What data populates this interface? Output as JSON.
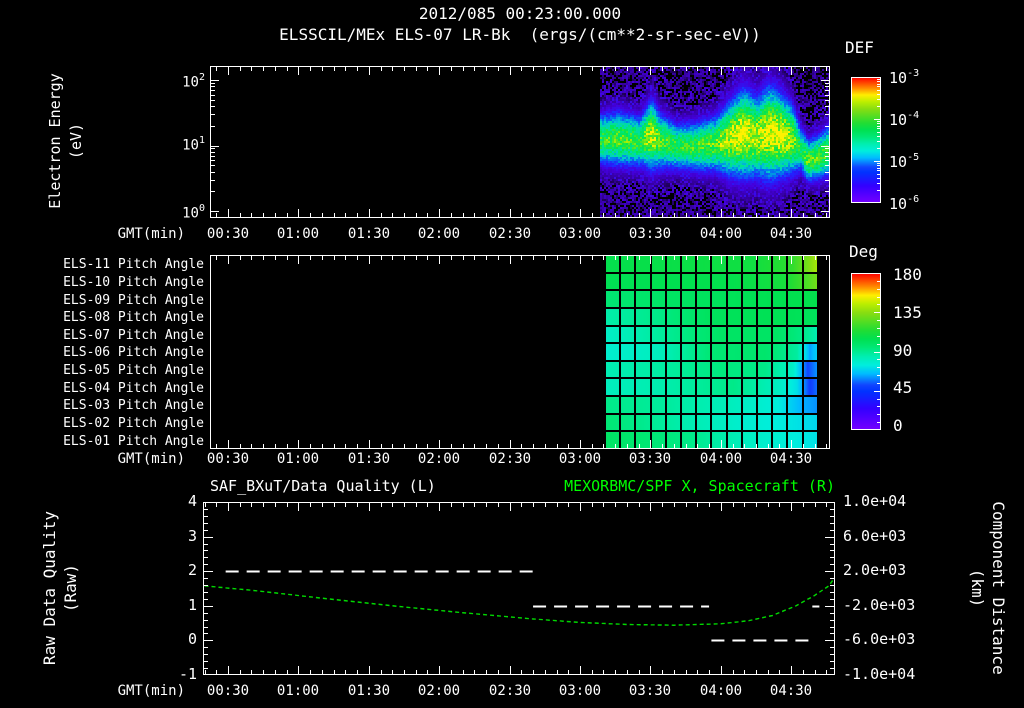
{
  "colors": {
    "background": "#000000",
    "foreground": "#ffffff",
    "trace_green": "#00d800",
    "title_green": "#00ff00",
    "quality_dash_white": "#ffffff"
  },
  "title": {
    "line1": "2012/085 00:23:00.000",
    "line2": "ELSSCIL/MEx ELS-07 LR-Bk  (ergs/(cm**2-sr-sec-eV))"
  },
  "time_axis": {
    "label": "GMT(min)",
    "ticks": [
      "00:30",
      "01:00",
      "01:30",
      "02:00",
      "02:30",
      "03:00",
      "03:30",
      "04:00",
      "04:30"
    ],
    "tick_minutes": [
      30,
      60,
      90,
      120,
      150,
      180,
      210,
      240,
      270
    ],
    "minor_step_minutes": 5
  },
  "panel1": {
    "ylabel_line1": "Electron Energy",
    "ylabel_line2": "(eV)",
    "yticks": [
      {
        "base": "10",
        "exp": "2"
      },
      {
        "base": "10",
        "exp": "1"
      },
      {
        "base": "10",
        "exp": "0"
      }
    ],
    "colorbar": {
      "title": "DEF",
      "ticks": [
        {
          "base": "10",
          "exp": "-3"
        },
        {
          "base": "10",
          "exp": "-4"
        },
        {
          "base": "10",
          "exp": "-5"
        },
        {
          "base": "10",
          "exp": "-6"
        }
      ]
    }
  },
  "panel2": {
    "row_labels": [
      "ELS-11 Pitch Angle",
      "ELS-10 Pitch Angle",
      "ELS-09 Pitch Angle",
      "ELS-08 Pitch Angle",
      "ELS-07 Pitch Angle",
      "ELS-06 Pitch Angle",
      "ELS-05 Pitch Angle",
      "ELS-04 Pitch Angle",
      "ELS-03 Pitch Angle",
      "ELS-02 Pitch Angle",
      "ELS-01 Pitch Angle"
    ],
    "colorbar": {
      "title": "Deg",
      "ticks": [
        "180",
        "135",
        "90",
        "45",
        "0"
      ]
    }
  },
  "panel3": {
    "title_left": "SAF_BXuT/Data Quality (L)",
    "title_right": "MEXORBMC/SPF X, Spacecraft (R)",
    "ylabel_left_line1": "Raw Data Quality",
    "ylabel_left_line2": "(Raw)",
    "yticks_left": [
      "4",
      "3",
      "2",
      "1",
      "0",
      "-1"
    ],
    "ylabel_right_line1": "Component Distance",
    "ylabel_right_line2": "(km)",
    "yticks_right": [
      "1.0e+04",
      "6.0e+03",
      "2.0e+03",
      "-2.0e+03",
      "-6.0e+03",
      "-1.0e+04"
    ]
  },
  "chart_data": [
    {
      "type": "heatmap",
      "name": "electron_energy_spectrogram",
      "title": "ELSSCIL/MEx ELS-07 LR-Bk",
      "units": "ergs/(cm**2-sr-sec-eV)",
      "ylabel": "Electron Energy (eV)",
      "y_scale": "log",
      "ylim_ev": [
        1,
        160
      ],
      "x_axis": "GMT(min) from ~00:20 to ~04:50",
      "data_coverage": "black (no data) before ~03:08; spectrogram from ~03:08 to right edge",
      "color_scale": {
        "label": "DEF",
        "min": 1e-06,
        "max": 0.001,
        "scale": "log",
        "palette": "rainbow, red=high, violet=low"
      },
      "band_keyframes_format": "[frac_of_data_width, band_center_eV, rel_intensity_0to1, band_width_decades]",
      "band_keyframes": [
        [
          0.0,
          13,
          0.78,
          0.55
        ],
        [
          0.08,
          13,
          0.82,
          0.6
        ],
        [
          0.17,
          12,
          0.8,
          0.55
        ],
        [
          0.22,
          15,
          0.95,
          0.75
        ],
        [
          0.26,
          12,
          0.82,
          0.6
        ],
        [
          0.33,
          10,
          0.78,
          0.5
        ],
        [
          0.42,
          10,
          0.8,
          0.55
        ],
        [
          0.5,
          11,
          0.85,
          0.6
        ],
        [
          0.56,
          13,
          0.95,
          0.8
        ],
        [
          0.62,
          16,
          1.0,
          0.95
        ],
        [
          0.68,
          14,
          0.95,
          0.85
        ],
        [
          0.73,
          16,
          1.0,
          1.0
        ],
        [
          0.78,
          15,
          1.0,
          0.9
        ],
        [
          0.83,
          13,
          0.92,
          0.75
        ],
        [
          0.87,
          9,
          0.72,
          0.5
        ],
        [
          0.9,
          6,
          0.85,
          0.45
        ],
        [
          0.95,
          7,
          0.82,
          0.5
        ],
        [
          1.0,
          9,
          0.8,
          0.55
        ]
      ],
      "description": "blue/violet noise speckle over 1-160 eV with bright green band near 6-20 eV, brightening to yellow-green ~04:05-04:25, band dips to ~5-8 eV near 04:30"
    },
    {
      "type": "heatmap",
      "name": "pitch_angle_panel",
      "units": "deg",
      "color_scale": {
        "label": "Deg",
        "min": 0,
        "max": 180,
        "palette": "rainbow, red=180, violet=0"
      },
      "data_coverage": "black (no data) before ~03:08; gridded cells ~9 min wide after",
      "profile_format": "[frac_of_data_width, pitch_angle_deg]",
      "rows": [
        {
          "label": "ELS-11 Pitch Angle",
          "profile": [
            [
              0,
              106
            ],
            [
              0.7,
              110
            ],
            [
              0.88,
              118
            ],
            [
              0.95,
              132
            ],
            [
              1,
              142
            ]
          ]
        },
        {
          "label": "ELS-10 Pitch Angle",
          "profile": [
            [
              0,
              104
            ],
            [
              0.6,
              106
            ],
            [
              0.85,
              112
            ],
            [
              0.95,
              124
            ],
            [
              1,
              132
            ]
          ]
        },
        {
          "label": "ELS-09 Pitch Angle",
          "profile": [
            [
              0,
              96
            ],
            [
              0.3,
              100
            ],
            [
              0.7,
              104
            ],
            [
              1,
              106
            ]
          ]
        },
        {
          "label": "ELS-08 Pitch Angle",
          "profile": [
            [
              0,
              86
            ],
            [
              0.25,
              92
            ],
            [
              0.5,
              102
            ],
            [
              0.8,
              104
            ],
            [
              1,
              102
            ]
          ]
        },
        {
          "label": "ELS-07 Pitch Angle",
          "profile": [
            [
              0,
              80
            ],
            [
              0.3,
              90
            ],
            [
              0.55,
              100
            ],
            [
              0.8,
              100
            ],
            [
              0.93,
              92
            ],
            [
              1,
              84
            ]
          ]
        },
        {
          "label": "ELS-06 Pitch Angle",
          "profile": [
            [
              0,
              78
            ],
            [
              0.25,
              82
            ],
            [
              0.5,
              96
            ],
            [
              0.75,
              98
            ],
            [
              0.9,
              88
            ],
            [
              0.96,
              62
            ],
            [
              1,
              70
            ]
          ]
        },
        {
          "label": "ELS-05 Pitch Angle",
          "profile": [
            [
              0,
              84
            ],
            [
              0.3,
              88
            ],
            [
              0.55,
              94
            ],
            [
              0.75,
              92
            ],
            [
              0.88,
              80
            ],
            [
              0.95,
              52
            ],
            [
              1,
              62
            ]
          ]
        },
        {
          "label": "ELS-04 Pitch Angle",
          "profile": [
            [
              0,
              82
            ],
            [
              0.3,
              86
            ],
            [
              0.6,
              92
            ],
            [
              0.8,
              82
            ],
            [
              0.9,
              72
            ],
            [
              0.96,
              50
            ],
            [
              1,
              58
            ]
          ]
        },
        {
          "label": "ELS-03 Pitch Angle",
          "profile": [
            [
              0,
              92
            ],
            [
              0.3,
              88
            ],
            [
              0.6,
              82
            ],
            [
              0.8,
              76
            ],
            [
              0.92,
              64
            ],
            [
              1,
              60
            ]
          ]
        },
        {
          "label": "ELS-02 Pitch Angle",
          "profile": [
            [
              0,
              96
            ],
            [
              0.35,
              86
            ],
            [
              0.65,
              78
            ],
            [
              0.85,
              74
            ],
            [
              1,
              70
            ]
          ]
        },
        {
          "label": "ELS-01 Pitch Angle",
          "profile": [
            [
              0,
              100
            ],
            [
              0.4,
              92
            ],
            [
              0.7,
              80
            ],
            [
              0.85,
              76
            ],
            [
              1,
              72
            ]
          ]
        }
      ]
    },
    {
      "type": "line",
      "name": "quality_and_spacecraft_x",
      "ylim_left": [
        -1,
        4
      ],
      "ylim_right": [
        -10000,
        10000
      ],
      "series": [
        {
          "name": "SAF_BXuT/Data Quality (L)",
          "axis": "left",
          "style": "white dashed step segments",
          "segments_format": "{t_min_range:[start,end], value:left_axis_units}",
          "segments": [
            {
              "t_min_range": [
                29,
                160
              ],
              "value": 2
            },
            {
              "t_min_range": [
                160,
                235
              ],
              "value": 1
            },
            {
              "t_min_range": [
                236,
                278
              ],
              "value": 0
            },
            {
              "t_min_range": [
                279,
                282
              ],
              "value": 1
            }
          ]
        },
        {
          "name": "MEXORBMC/SPF X, Spacecraft (R)",
          "axis": "right",
          "color": "#00d800",
          "style": "green dotted curve",
          "points_format": "[gmt_minutes, km]",
          "points": [
            [
              20,
              300
            ],
            [
              40,
              -200
            ],
            [
              70,
              -1120
            ],
            [
              100,
              -2000
            ],
            [
              130,
              -2800
            ],
            [
              160,
              -3520
            ],
            [
              180,
              -3920
            ],
            [
              200,
              -4160
            ],
            [
              220,
              -4240
            ],
            [
              240,
              -4080
            ],
            [
              252,
              -3720
            ],
            [
              262,
              -3120
            ],
            [
              272,
              -2000
            ],
            [
              280,
              -800
            ],
            [
              286,
              300
            ],
            [
              290,
              1150
            ]
          ]
        }
      ]
    }
  ]
}
